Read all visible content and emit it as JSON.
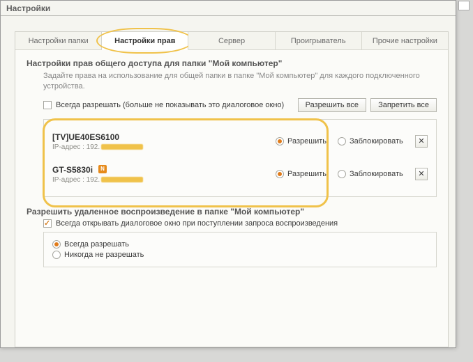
{
  "window": {
    "title": "Настройки"
  },
  "tabs": [
    {
      "label": "Настройки папки",
      "active": false
    },
    {
      "label": "Настройки прав",
      "active": true
    },
    {
      "label": "Сервер",
      "active": false
    },
    {
      "label": "Проигрыватель",
      "active": false
    },
    {
      "label": "Прочие настройки",
      "active": false
    }
  ],
  "permissions": {
    "title": "Настройки прав общего доступа для папки \"Мой компьютер\"",
    "description": "Задайте права на использование для общей папки в папке \"Мой компьютер\" для каждого подключенного устройства.",
    "always_allow_label": "Всегда разрешать (больше не показывать это диалоговое окно)",
    "allow_all_btn": "Разрешить все",
    "deny_all_btn": "Запретить все",
    "allow_label": "Разрешить",
    "block_label": "Заблокировать",
    "ip_prefix": "IP-адрес : 192.",
    "close_label": "✕",
    "n_badge": "N",
    "devices": [
      {
        "name": "[TV]UE40ES6100",
        "has_badge": false,
        "allow": true
      },
      {
        "name": "GT-S5830i",
        "has_badge": true,
        "allow": true
      }
    ]
  },
  "remote": {
    "title": "Разрешить удаленное воспроизведение в папке \"Мой компьютер\"",
    "checkbox_label": "Всегда открывать диалоговое окно при поступлении запроса воспроизведения",
    "option_allow": "Всегда разрешать",
    "option_deny": "Никогда не разрешать"
  }
}
